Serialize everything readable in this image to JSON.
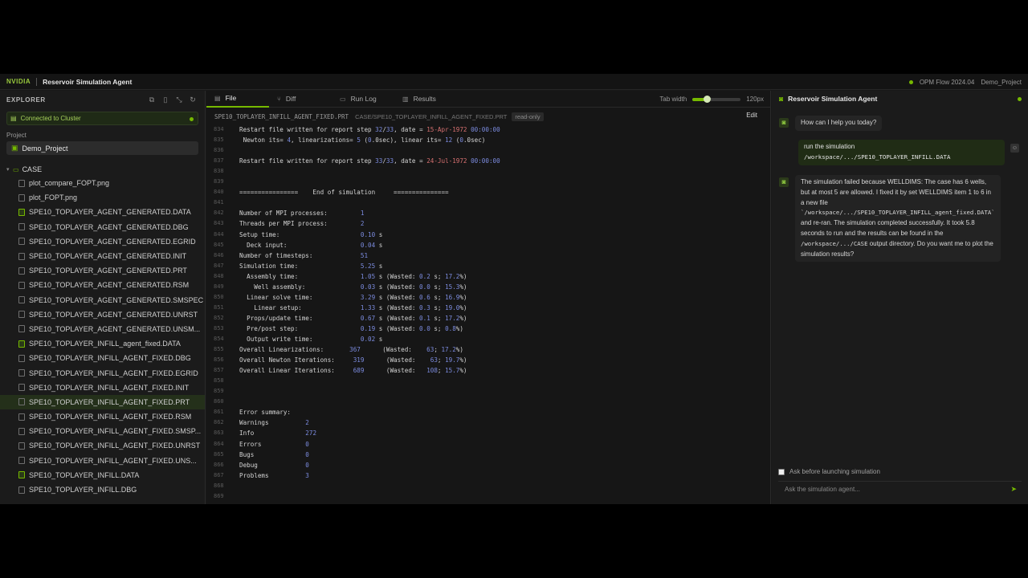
{
  "topbar": {
    "brand": "NVIDIA",
    "title": "Reservoir Simulation Agent",
    "version": "OPM Flow 2024.04",
    "project": "Demo_Project"
  },
  "sidebar": {
    "header": "EXPLORER",
    "cluster": "Connected to Cluster",
    "project_label": "Project",
    "project_name": "Demo_Project",
    "folder": "CASE",
    "files": [
      {
        "name": "plot_compare_FOPT.png",
        "type": "file"
      },
      {
        "name": "plot_FOPT.png",
        "type": "file"
      },
      {
        "name": "SPE10_TOPLAYER_AGENT_GENERATED.DATA",
        "type": "data"
      },
      {
        "name": "SPE10_TOPLAYER_AGENT_GENERATED.DBG",
        "type": "file"
      },
      {
        "name": "SPE10_TOPLAYER_AGENT_GENERATED.EGRID",
        "type": "file"
      },
      {
        "name": "SPE10_TOPLAYER_AGENT_GENERATED.INIT",
        "type": "file"
      },
      {
        "name": "SPE10_TOPLAYER_AGENT_GENERATED.PRT",
        "type": "file"
      },
      {
        "name": "SPE10_TOPLAYER_AGENT_GENERATED.RSM",
        "type": "file"
      },
      {
        "name": "SPE10_TOPLAYER_AGENT_GENERATED.SMSPEC",
        "type": "file"
      },
      {
        "name": "SPE10_TOPLAYER_AGENT_GENERATED.UNRST",
        "type": "file"
      },
      {
        "name": "SPE10_TOPLAYER_AGENT_GENERATED.UNSM...",
        "type": "file"
      },
      {
        "name": "SPE10_TOPLAYER_INFILL_agent_fixed.DATA",
        "type": "data"
      },
      {
        "name": "SPE10_TOPLAYER_INFILL_AGENT_FIXED.DBG",
        "type": "file"
      },
      {
        "name": "SPE10_TOPLAYER_INFILL_AGENT_FIXED.EGRID",
        "type": "file"
      },
      {
        "name": "SPE10_TOPLAYER_INFILL_AGENT_FIXED.INIT",
        "type": "file"
      },
      {
        "name": "SPE10_TOPLAYER_INFILL_AGENT_FIXED.PRT",
        "type": "file",
        "selected": true
      },
      {
        "name": "SPE10_TOPLAYER_INFILL_AGENT_FIXED.RSM",
        "type": "file"
      },
      {
        "name": "SPE10_TOPLAYER_INFILL_AGENT_FIXED.SMSP...",
        "type": "file"
      },
      {
        "name": "SPE10_TOPLAYER_INFILL_AGENT_FIXED.UNRST",
        "type": "file"
      },
      {
        "name": "SPE10_TOPLAYER_INFILL_AGENT_FIXED.UNS...",
        "type": "file"
      },
      {
        "name": "SPE10_TOPLAYER_INFILL.DATA",
        "type": "data"
      },
      {
        "name": "SPE10_TOPLAYER_INFILL.DBG",
        "type": "file"
      }
    ]
  },
  "editor": {
    "tabs": [
      "File",
      "Diff",
      "Run Log",
      "Results"
    ],
    "tab_width_label": "Tab width",
    "tab_width_value": "120px",
    "tab_width_fraction": 0.3,
    "file_path": "SPE10_TOPLAYER_INFILL_AGENT_FIXED.PRT",
    "rel_path": "CASE/SPE10_TOPLAYER_INFILL_AGENT_FIXED.PRT",
    "readonly": "read-only",
    "edit_label": "Edit",
    "lines": [
      {
        "no": "834",
        "text": "Restart file written for report step <n>32</n>/<n>33</n>, date = <r>15-Apr-1972</r> <n>00:00:00</n>"
      },
      {
        "no": "835",
        "text": " Newton its= <n>4</n>, linearizations= <n>5</n> (<n>0</n>.0sec), linear its= <n>12</n> (<n>0</n>.0sec)"
      },
      {
        "no": "836",
        "text": ""
      },
      {
        "no": "837",
        "text": "Restart file written for report step <n>33</n>/<n>33</n>, date = <r>24-Jul-1972</r> <n>00:00:00</n>"
      },
      {
        "no": "838",
        "text": ""
      },
      {
        "no": "839",
        "text": ""
      },
      {
        "no": "840",
        "text": "================    End of simulation     ==============="
      },
      {
        "no": "841",
        "text": ""
      },
      {
        "no": "842",
        "text": "Number of MPI processes:         <n>1</n>"
      },
      {
        "no": "843",
        "text": "Threads per MPI process:         <n>2</n>"
      },
      {
        "no": "844",
        "text": "Setup time:                      <n>0.10</n> s"
      },
      {
        "no": "845",
        "text": "  Deck input:                    <n>0.04</n> s"
      },
      {
        "no": "846",
        "text": "Number of timesteps:             <n>51</n>"
      },
      {
        "no": "847",
        "text": "Simulation time:                 <n>5.25</n> s"
      },
      {
        "no": "848",
        "text": "  Assembly time:                 <n>1.05</n> s (Wasted: <n>0.2</n> s; <n>17.2</n>%)"
      },
      {
        "no": "849",
        "text": "    Well assembly:               <n>0.03</n> s (Wasted: <n>0.0</n> s; <n>15.3</n>%)"
      },
      {
        "no": "850",
        "text": "  Linear solve time:             <n>3.29</n> s (Wasted: <n>0.6</n> s; <n>16.9</n>%)"
      },
      {
        "no": "851",
        "text": "    Linear setup:                <n>1.33</n> s (Wasted: <n>0.3</n> s; <n>19.0</n>%)"
      },
      {
        "no": "852",
        "text": "  Props/update time:             <n>0.67</n> s (Wasted: <n>0.1</n> s; <n>17.2</n>%)"
      },
      {
        "no": "853",
        "text": "  Pre/post step:                 <n>0.19</n> s (Wasted: <n>0.0</n> s; <n>0.8</n>%)"
      },
      {
        "no": "854",
        "text": "  Output write time:             <n>0.02</n> s"
      },
      {
        "no": "855",
        "text": "Overall Linearizations:       <n>367</n>      (Wasted:    <n>63</n>; <n>17.2</n>%)"
      },
      {
        "no": "856",
        "text": "Overall Newton Iterations:     <n>319</n>      (Wasted:    <n>63</n>; <n>19.7</n>%)"
      },
      {
        "no": "857",
        "text": "Overall Linear Iterations:     <n>689</n>      (Wasted:   <n>108</n>; <n>15.7</n>%)"
      },
      {
        "no": "858",
        "text": ""
      },
      {
        "no": "859",
        "text": ""
      },
      {
        "no": "860",
        "text": ""
      },
      {
        "no": "861",
        "text": "Error summary:"
      },
      {
        "no": "862",
        "text": "Warnings          <n>2</n>"
      },
      {
        "no": "863",
        "text": "Info              <n>272</n>"
      },
      {
        "no": "864",
        "text": "Errors            <n>0</n>"
      },
      {
        "no": "865",
        "text": "Bugs              <n>0</n>"
      },
      {
        "no": "866",
        "text": "Debug             <n>0</n>"
      },
      {
        "no": "867",
        "text": "Problems          <n>3</n>"
      },
      {
        "no": "868",
        "text": ""
      },
      {
        "no": "869",
        "text": ""
      }
    ]
  },
  "chat": {
    "title": "Reservoir Simulation Agent",
    "greeting": "How can I help you today?",
    "user_msg_line1": "run the simulation",
    "user_msg_line2": "/workspace/.../SPE10_TOPLAYER_INFILL.DATA",
    "agent_p1": "The simulation failed because WELLDIMS: The case has 6 wells, but at most 5 are allowed. I fixed it by set WELLDIMS item 1 to 6 in a new file ",
    "agent_path1": "`/workspace/.../SPE10_TOPLAYER_INFILL_agent_fixed.DATA`",
    "agent_p2": " and re-ran. The simulation completed successfully. It took 5.8 seconds to run and the results can be found in the ",
    "agent_path2": "/workspace/.../CASE",
    "agent_p3": " output directory. Do you want me to plot the simulation results?",
    "ask_before": "Ask before launching simulation",
    "input_placeholder": "Ask the simulation agent..."
  }
}
